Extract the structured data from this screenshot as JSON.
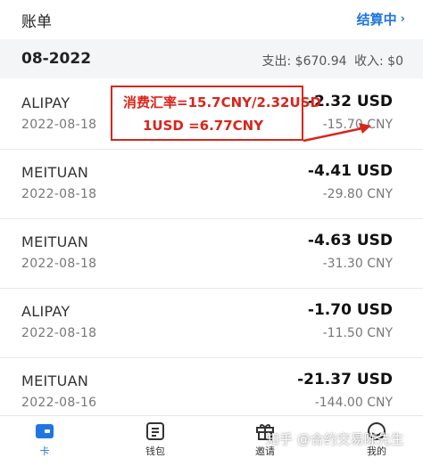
{
  "header": {
    "title": "账单",
    "settling_label": "结算中",
    "chevron": "›"
  },
  "month_bar": {
    "month": "08-2022",
    "expense": "支出: $670.94",
    "income": "收入: $0"
  },
  "transactions": [
    {
      "merchant": "ALIPAY",
      "date": "2022-08-18",
      "usd": "-2.32 USD",
      "cny": "-15.70 CNY"
    },
    {
      "merchant": "MEITUAN",
      "date": "2022-08-18",
      "usd": "-4.41 USD",
      "cny": "-29.80 CNY"
    },
    {
      "merchant": "MEITUAN",
      "date": "2022-08-18",
      "usd": "-4.63 USD",
      "cny": "-31.30 CNY"
    },
    {
      "merchant": "ALIPAY",
      "date": "2022-08-18",
      "usd": "-1.70 USD",
      "cny": "-11.50 CNY"
    },
    {
      "merchant": "MEITUAN",
      "date": "2022-08-16",
      "usd": "-21.37 USD",
      "cny": "-144.00 CNY"
    }
  ],
  "annotation": {
    "line1": "消费汇率=15.7CNY/2.32USD",
    "line2": "1USD =6.77CNY",
    "color": "#d9251c"
  },
  "tabs": [
    {
      "label": "卡",
      "icon": "card-icon",
      "active": true
    },
    {
      "label": "钱包",
      "icon": "wallet-icon",
      "active": false
    },
    {
      "label": "邀请",
      "icon": "gift-icon",
      "active": false
    },
    {
      "label": "我的",
      "icon": "profile-icon",
      "active": false
    }
  ],
  "watermark": "知乎 @合约交易陈先生",
  "colors": {
    "accent": "#1f76e0",
    "annotation": "#d9251c",
    "month_bar_bg": "#f4f5f7"
  }
}
